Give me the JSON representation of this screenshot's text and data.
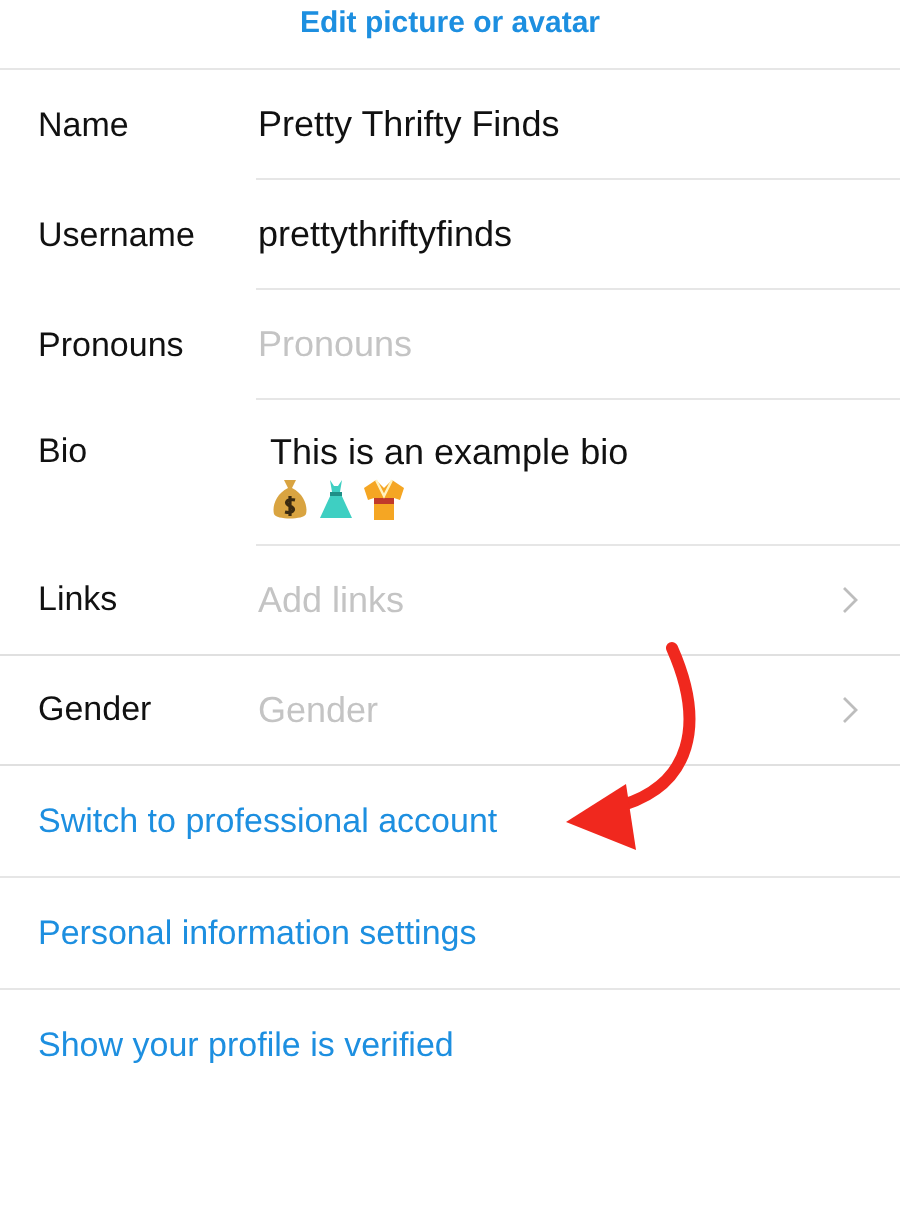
{
  "edit_picture_link": "Edit picture or avatar",
  "fields": [
    {
      "kind": "input",
      "label": "Name",
      "value": "Pretty Thrifty Finds"
    },
    {
      "kind": "input",
      "label": "Username",
      "value": "prettythriftyfinds"
    },
    {
      "kind": "input",
      "label": "Pronouns",
      "placeholder": "Pronouns"
    },
    {
      "kind": "bio",
      "label": "Bio",
      "value": "This is an example bio"
    },
    {
      "kind": "nav",
      "label": "Links",
      "placeholder": "Add links"
    },
    {
      "kind": "nav",
      "label": "Gender",
      "placeholder": "Gender"
    }
  ],
  "links": [
    "Switch to professional account",
    "Personal information settings",
    "Show your profile is verified"
  ]
}
